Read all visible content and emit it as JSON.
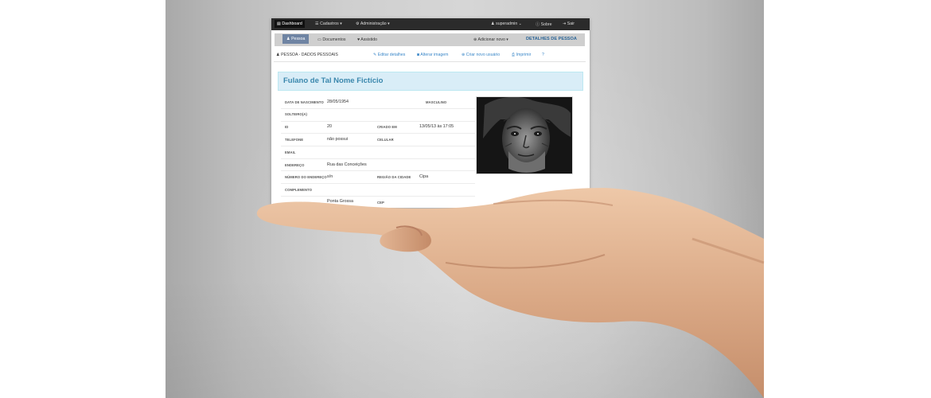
{
  "nav": {
    "items": [
      {
        "label": "Dashboard",
        "icon": "chart-icon",
        "active": true
      },
      {
        "label": "Cadastros",
        "icon": "list-icon",
        "caret": true
      },
      {
        "label": "Administração",
        "icon": "gear-icon",
        "caret": true
      }
    ],
    "user": "superadmin",
    "about": "Sobre",
    "logout": "Sair"
  },
  "subbar": {
    "tabs": [
      {
        "label": "Pessoa",
        "icon": "user-icon",
        "active": true
      },
      {
        "label": "Documentos",
        "icon": "card-icon"
      },
      {
        "label": "Assistido",
        "icon": "heart-icon"
      }
    ],
    "add_new": "Adicionar novo",
    "details_title": "DETALHES DE PESSOA"
  },
  "actions": {
    "section_title": "PESSOA - DADOS PESSOAIS",
    "edit": "Editar detalhes",
    "change_image": "Alterar imagem",
    "new_user": "Criar novo usuário",
    "print": "Imprimir"
  },
  "person": {
    "name": "Fulano de Tal Nome Fictício",
    "fields": {
      "birth_label": "DATA DE NASCIMENTO",
      "birth_value": "28/05/1954",
      "gender": "MASCULINO",
      "marital": "SOLTEIRO(A)",
      "id_label": "ID",
      "id_value": "20",
      "created_label": "CRIADO EM",
      "created_value": "13/05/13 às 17:05",
      "phone_label": "TELEFONE",
      "phone_value": "não possui",
      "cell_label": "CELULAR",
      "email_label": "EMAIL",
      "address_label": "ENDEREÇO",
      "address_value": "Rua das Conceições",
      "number_label": "NÚMERO DO ENDEREÇO",
      "number_value": "s/n",
      "region_label": "REGIÃO DA CIDADE",
      "region_value": "Cipa",
      "complement_label": "COMPLEMENTO",
      "city_value": "Ponta Grossa",
      "cep_label": "CEP"
    }
  },
  "colors": {
    "nav_bg": "#2b2b2b",
    "tab_active": "#6f84a3",
    "link": "#3a87c8",
    "name_panel": "#d9edf7",
    "name_text": "#3a87ad"
  }
}
